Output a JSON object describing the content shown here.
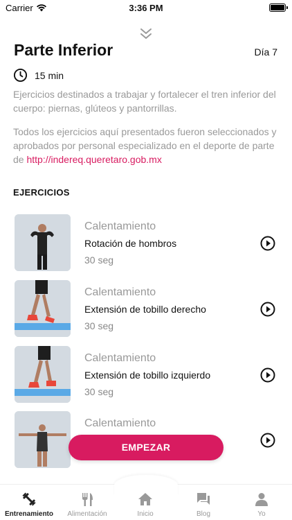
{
  "status_bar": {
    "carrier": "Carrier",
    "time": "3:36 PM"
  },
  "header": {
    "title": "Parte Inferior",
    "day": "Día 7"
  },
  "duration": {
    "text": "15 min",
    "icon": "clock-icon"
  },
  "description": {
    "p1": "Ejercicios destinados a trabajar y fortalecer el tren inferior del cuerpo: piernas, glúteos y pantorrillas.",
    "p2_text": "Todos los ejercicios aquí presentados fueron seleccionados y aprobados por personal especializado en el deporte de parte de ",
    "p2_link": "http://indereq.queretaro.gob.mx"
  },
  "section_title": "EJERCICIOS",
  "exercises": [
    {
      "category": "Calentamiento",
      "name": "Rotación de hombros",
      "duration": "30 seg"
    },
    {
      "category": "Calentamiento",
      "name": "Extensión de tobillo derecho",
      "duration": "30 seg"
    },
    {
      "category": "Calentamiento",
      "name": "Extensión de tobillo izquierdo",
      "duration": "30 seg"
    },
    {
      "category": "Calentamiento",
      "name": "",
      "duration": ""
    }
  ],
  "start_button": "EMPEZAR",
  "tabs": [
    {
      "label": "Entrenamiento",
      "icon": "dumbbell-icon",
      "active": true
    },
    {
      "label": "Alimentación",
      "icon": "fork-knife-icon",
      "active": false
    },
    {
      "label": "Inicio",
      "icon": "home-icon",
      "active": false
    },
    {
      "label": "Blog",
      "icon": "chat-icon",
      "active": false
    },
    {
      "label": "Yo",
      "icon": "user-icon",
      "active": false
    }
  ],
  "colors": {
    "accent": "#d81b60",
    "muted_text": "#999999",
    "thumb_bg": "#cfd6dd",
    "mat_blue": "#5aa9e6"
  }
}
